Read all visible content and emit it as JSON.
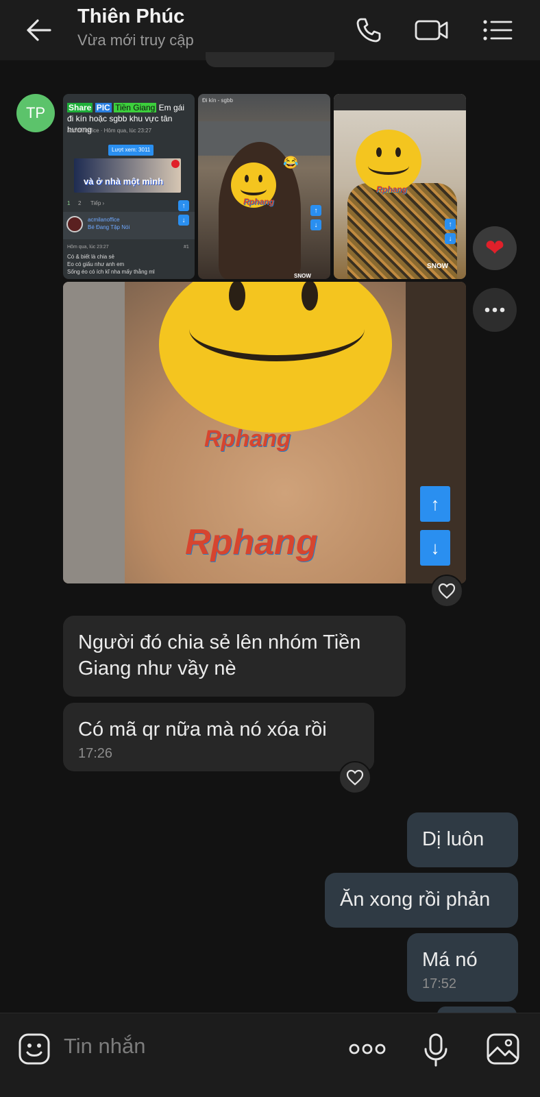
{
  "header": {
    "title": "Thiên Phúc",
    "status": "Vừa mới truy cập"
  },
  "avatar": {
    "initials": "TP"
  },
  "photo1": {
    "tag_share": "Share",
    "tag_pic": "PIC",
    "tag_place": "Tiền Giang",
    "headline": "Em gái đi kín hoặc sgbb khu vực tân hương",
    "author_line": "acmilanoffice · Hôm qua, lúc 23:27",
    "views": "Lượt xem: 3011",
    "caption": "và ở nhà một mình",
    "page1": "1",
    "page2": "2",
    "next": "Tiếp ›",
    "user": "acmilanoffice",
    "rank": "Bé Đang Tập Nói",
    "post_time": "Hôm qua, lúc 23:27",
    "post_no": "#1",
    "line1": "Có & biết là chia sẻ",
    "line2": "Eo có giấu như anh em",
    "line3": "Sống éo có ích kĩ nha mấy thằng ml"
  },
  "photo2": {
    "top_label": "Đi kín - sgbb",
    "watermark": "Rphang",
    "bottom_label": "SNOW"
  },
  "photo3": {
    "watermark": "Rphang",
    "bottom_label": "SNOW"
  },
  "photo4": {
    "watermark_small": "Rphang",
    "watermark_large": "Rphang"
  },
  "messages": {
    "in1": "Người đó chia sẻ lên nhóm Tiền Giang như vầy nè",
    "in2": "Có mã qr  nữa mà nó xóa rồi",
    "in2_time": "17:26",
    "out1": "Dị luôn",
    "out2": "Ăn xong rồi phản",
    "out3": "Má nó",
    "out3_time": "17:52"
  },
  "composer": {
    "placeholder": "Tin nhắn"
  },
  "colors": {
    "accent_blue": "#2a8ff0",
    "heart_red": "#e0202a",
    "avatar_green": "#5cc36b"
  }
}
